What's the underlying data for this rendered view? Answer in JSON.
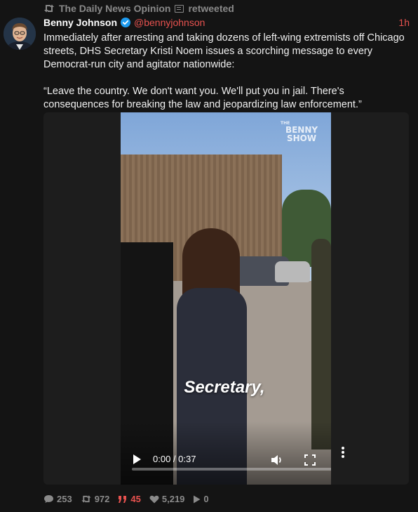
{
  "retweet": {
    "account": "The Daily News Opinion",
    "action": "retweeted"
  },
  "post": {
    "author_name": "Benny Johnson",
    "handle": "@bennyjohnson",
    "time": "1h",
    "paragraph_1": "Immediately after arresting and taking dozens of left-wing extremists off Chicago streets, DHS Secretary Kristi Noem issues a scorching message to every Democrat-run city and agitator nationwide:",
    "paragraph_2": "“Leave the country. We don't want you. We'll put you in jail. There's consequences for breaking the law and jeopardizing law enforcement.”"
  },
  "video": {
    "caption": "Secretary,",
    "watermark_line1": "THE",
    "watermark_line2": "BENNY",
    "watermark_line3": "SHOW",
    "time": "0:00 / 0:37",
    "progress": 0.0
  },
  "stats": {
    "replies": "253",
    "retweets": "972",
    "quotes": "45",
    "likes": "5,219",
    "views": "0"
  },
  "colors": {
    "accent": "#e8524f",
    "muted": "#8a8a8a",
    "verified": "#1d9bf0",
    "background": "#141414"
  }
}
